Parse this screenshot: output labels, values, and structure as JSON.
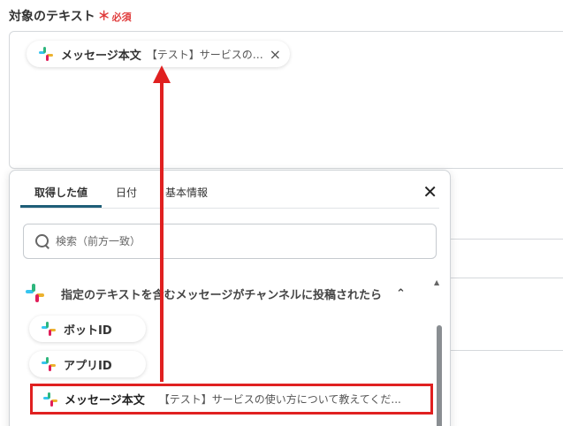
{
  "field": {
    "label": "対象のテキスト",
    "required_mark": "＊",
    "required_text": "必須"
  },
  "selected_chip": {
    "label": "メッセージ本文",
    "value": "【テスト】サービスの…",
    "remove_icon": "×"
  },
  "panel": {
    "tabs": [
      {
        "label": "取得した値"
      },
      {
        "label": "日付"
      },
      {
        "label": "基本情報"
      }
    ],
    "close_icon": "✕",
    "search": {
      "placeholder": "検索（前方一致）"
    },
    "section": {
      "title": "指定のテキストを含むメッセージがチャンネルに投稿されたら",
      "chevron": "⌃"
    },
    "items": [
      {
        "label": "ボットID"
      },
      {
        "label": "アプリID"
      },
      {
        "label": "メッセージ本文",
        "value": "【テスト】サービスの使い方について教えてくだ..."
      }
    ]
  },
  "colors": {
    "accent": "#1e5e78",
    "required": "#e03c3c",
    "annotation": "#e02020"
  }
}
